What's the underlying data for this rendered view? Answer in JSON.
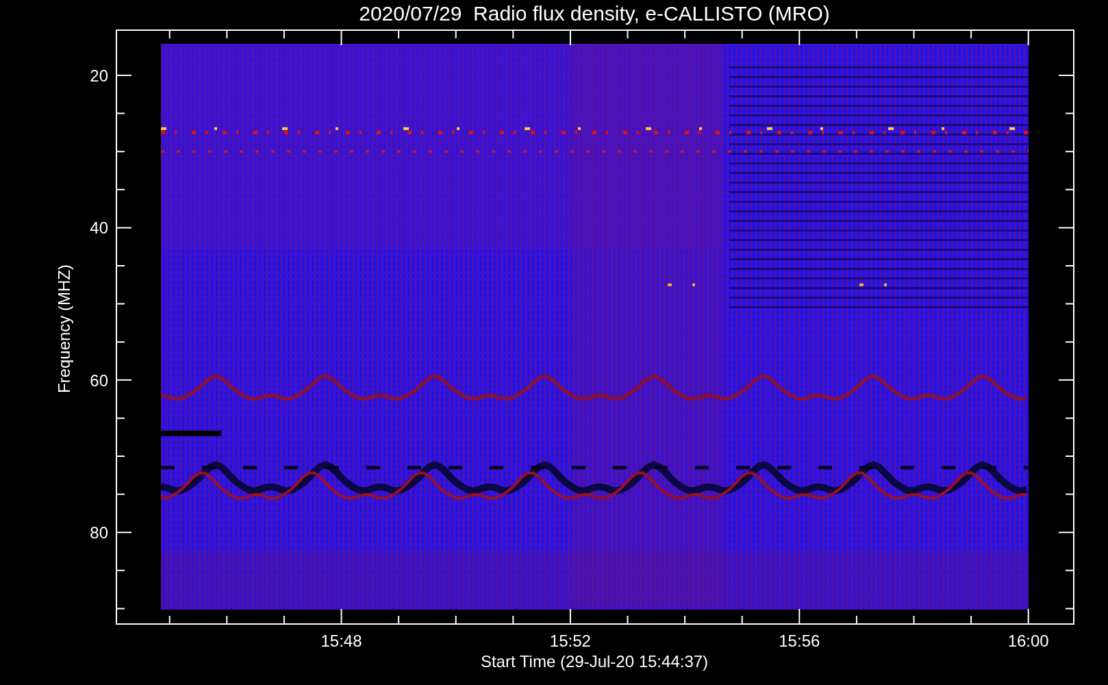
{
  "title": "2020/07/29  Radio flux density, e-CALLISTO (MRO)",
  "y_axis": {
    "label": "Frequency (MHZ)",
    "ticks": [
      "20",
      "40",
      "60",
      "80"
    ]
  },
  "x_axis": {
    "label": "Start Time (29-Jul-20 15:44:37)",
    "ticks": [
      "15:48",
      "15:52",
      "15:56",
      "16:00"
    ]
  }
}
